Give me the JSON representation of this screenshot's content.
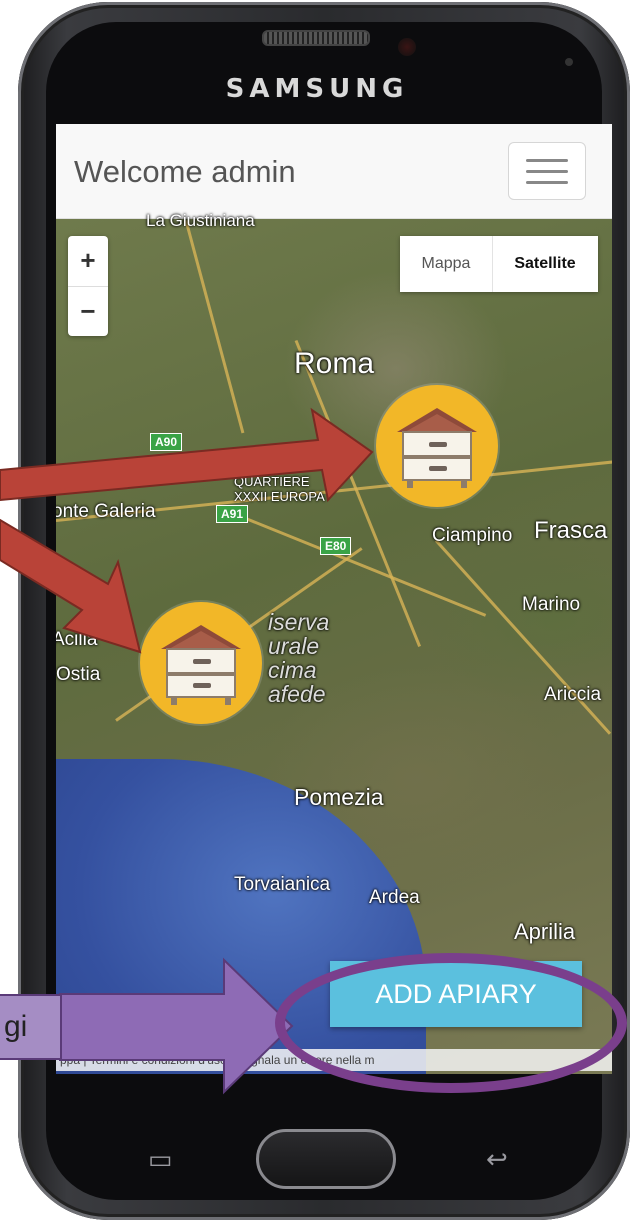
{
  "device": {
    "brand": "SAMSUNG"
  },
  "header": {
    "title": "Welcome admin",
    "menu_icon": "hamburger-menu-icon"
  },
  "map": {
    "zoom_in": "+",
    "zoom_out": "−",
    "map_type": {
      "map_label": "Mappa",
      "satellite_label": "Satellite"
    },
    "places": {
      "roma": "Roma",
      "la_giustiniana": "La Giustiniana",
      "quartiere": "QUARTIERE",
      "quartiere2": "XXXII EUROPA",
      "ponte_galeria": "onte Galeria",
      "ciampino": "Ciampino",
      "frascati": "Frasca",
      "marino": "Marino",
      "ostia": "Ostia",
      "acilia": "Acilia",
      "ariccia": "Ariccia",
      "pomezia": "Pomezia",
      "torvaianica": "Torvaianica",
      "ardea": "Ardea",
      "aprilia": "Aprilia",
      "riserva1": "iserva",
      "riserva2": "urale",
      "riserva3": "cima",
      "riserva4": "afede"
    },
    "road_shields": {
      "a90": "A90",
      "a91": "A91",
      "e80": "E80"
    },
    "markers": [
      {
        "name": "apiary-marker-1",
        "icon": "beehive-icon"
      },
      {
        "name": "apiary-marker-2",
        "icon": "beehive-icon"
      }
    ],
    "attribution": "ppa | Termini e condizioni d'uso | Segnala un errore nella m"
  },
  "actions": {
    "add_apiary": "ADD APIARY"
  },
  "annotation": {
    "callout_text": "gi"
  },
  "colors": {
    "primary_button": "#5bc0de",
    "marker": "#f2b728",
    "red_arrow": "#b94338",
    "purple_arrow": "#8e6bb5"
  }
}
